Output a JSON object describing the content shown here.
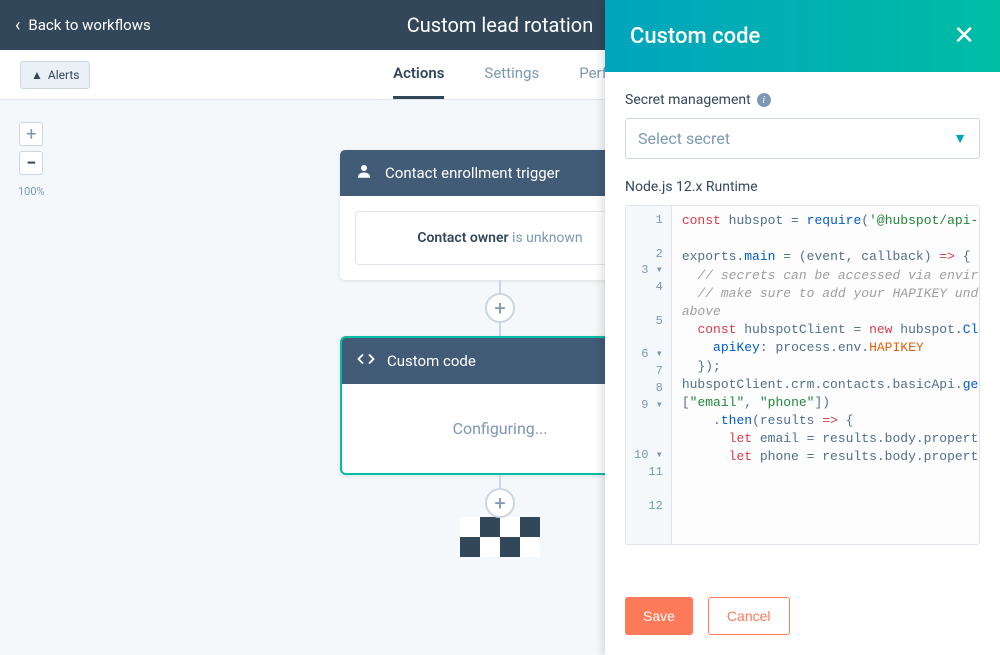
{
  "header": {
    "back_label": "Back to workflows",
    "page_title": "Custom lead rotation"
  },
  "secondary": {
    "alerts_label": "Alerts",
    "tabs": {
      "actions": "Actions",
      "settings": "Settings",
      "performance": "Perf"
    }
  },
  "zoom": {
    "percent": "100%"
  },
  "workflow": {
    "trigger_title": "Contact enrollment trigger",
    "trigger_body_strong": "Contact owner",
    "trigger_body_rest": " is unknown",
    "custom_title": "Custom code",
    "custom_body": "Configuring..."
  },
  "panel": {
    "title": "Custom code",
    "secret_label": "Secret management",
    "secret_placeholder": "Select secret",
    "runtime_label": "Node.js 12.x Runtime",
    "code_lines": {
      "gutter": " 1\n\n 2\n 3 ▾\n 4\n\n 5\n\n 6 ▾\n 7\n 8\n 9 ▾\n\n\n10 ▾\n11\n\n12\n"
    },
    "save_label": "Save",
    "cancel_label": "Cancel"
  }
}
